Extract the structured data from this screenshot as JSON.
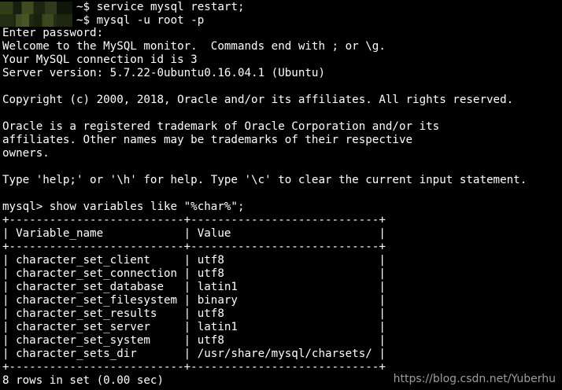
{
  "terminal": {
    "prompt_line_1": "~$ service mysql restart;",
    "prompt_line_2": "~$ mysql -u root -p",
    "lines": [
      "Enter password:",
      "Welcome to the MySQL monitor.  Commands end with ; or \\g.",
      "Your MySQL connection id is 3",
      "Server version: 5.7.22-0ubuntu0.16.04.1 (Ubuntu)",
      "",
      "Copyright (c) 2000, 2018, Oracle and/or its affiliates. All rights reserved.",
      "",
      "Oracle is a registered trademark of Oracle Corporation and/or its",
      "affiliates. Other names may be trademarks of their respective",
      "owners.",
      "",
      "Type 'help;' or '\\h' for help. Type '\\c' to clear the current input statement.",
      "",
      "mysql> show variables like \"%char%\";",
      "+--------------------------+----------------------------+",
      "| Variable_name            | Value                      |",
      "+--------------------------+----------------------------+",
      "| character_set_client     | utf8                       |",
      "| character_set_connection | utf8                       |",
      "| character_set_database   | latin1                     |",
      "| character_set_filesystem | binary                     |",
      "| character_set_results    | utf8                       |",
      "| character_set_server     | latin1                     |",
      "| character_set_system     | utf8                       |",
      "| character_sets_dir       | /usr/share/mysql/charsets/ |",
      "+--------------------------+----------------------------+",
      "8 rows in set (0.00 sec)"
    ]
  },
  "watermark": "https://blog.csdn.net/Yuberhu"
}
